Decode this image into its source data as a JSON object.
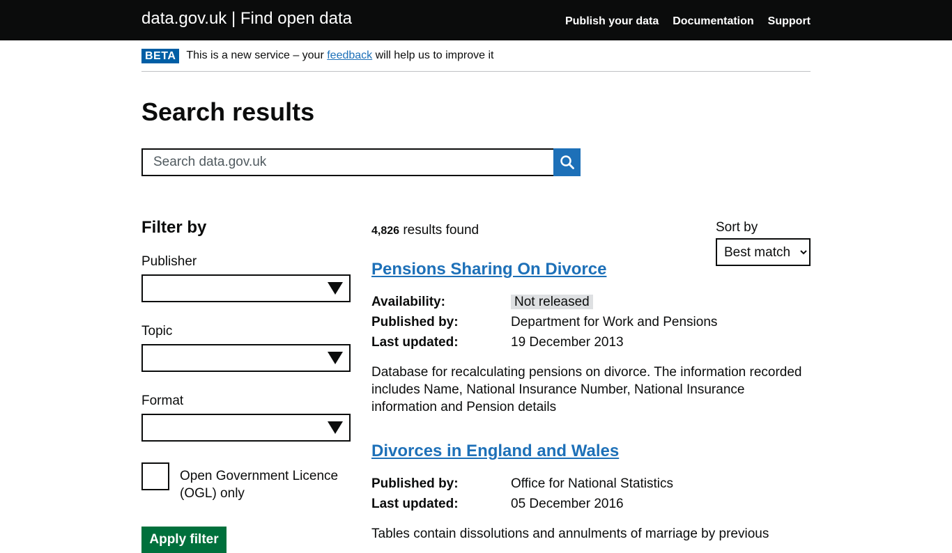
{
  "header": {
    "site_title": "data.gov.uk | Find open data",
    "nav": [
      {
        "label": "Publish your data"
      },
      {
        "label": "Documentation"
      },
      {
        "label": "Support"
      }
    ]
  },
  "beta_banner": {
    "tag": "BETA",
    "text_before": "This is a new service – your ",
    "link": "feedback",
    "text_after": " will help us to improve it"
  },
  "page_title": "Search results",
  "search": {
    "placeholder": "Search data.gov.uk",
    "value": "",
    "button_icon": "search-icon",
    "colors": {
      "button": "#1d70b8"
    }
  },
  "filter": {
    "heading": "Filter by",
    "selects": [
      {
        "label": "Publisher",
        "value": ""
      },
      {
        "label": "Topic",
        "value": ""
      },
      {
        "label": "Format",
        "value": ""
      }
    ],
    "ogl_checkbox": {
      "label": "Open Government Licence (OGL) only",
      "checked": false
    },
    "apply_button": "Apply filter"
  },
  "results": {
    "count": "4,826",
    "count_suffix": " results found",
    "sort": {
      "label": "Sort by",
      "selected": "Best match"
    },
    "items": [
      {
        "title": "Pensions Sharing On Divorce",
        "availability_label": "Availability:",
        "availability": "Not released",
        "published_by_label": "Published by:",
        "published_by": "Department for Work and Pensions",
        "last_updated_label": "Last updated:",
        "last_updated": "19 December 2013",
        "description": "Database for recalculating pensions on divorce. The information recorded includes Name, National Insurance Number, National Insurance information and Pension details"
      },
      {
        "title": "Divorces in England and Wales",
        "published_by_label": "Published by:",
        "published_by": "Office for National Statistics",
        "last_updated_label": "Last updated:",
        "last_updated": "05 December 2016",
        "description": "Tables contain dissolutions and annulments of marriage by previous"
      }
    ]
  }
}
